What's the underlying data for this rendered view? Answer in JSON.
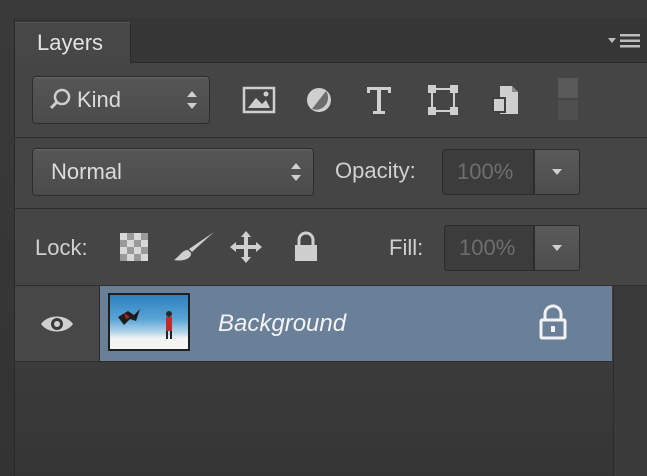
{
  "panel": {
    "tab_label": "Layers",
    "menu_icon": "panel-menu-icon"
  },
  "filter_bar": {
    "kind_label": "Kind",
    "icons": [
      "pixel-layer-filter-icon",
      "adjustment-layer-filter-icon",
      "type-layer-filter-icon",
      "shape-layer-filter-icon",
      "smart-object-filter-icon"
    ]
  },
  "blend_bar": {
    "blend_mode": "Normal",
    "opacity_label": "Opacity:",
    "opacity_value": "100%"
  },
  "lock_bar": {
    "lock_label": "Lock:",
    "icons": [
      "lock-transparent-pixels-icon",
      "lock-image-pixels-icon",
      "lock-position-icon",
      "lock-all-icon"
    ],
    "fill_label": "Fill:",
    "fill_value": "100%"
  },
  "layers": [
    {
      "name": "Background",
      "visible": true,
      "locked": true,
      "selected": true
    }
  ],
  "colors": {
    "panel_bg": "#404040",
    "selected_layer": "#6a7f98"
  }
}
